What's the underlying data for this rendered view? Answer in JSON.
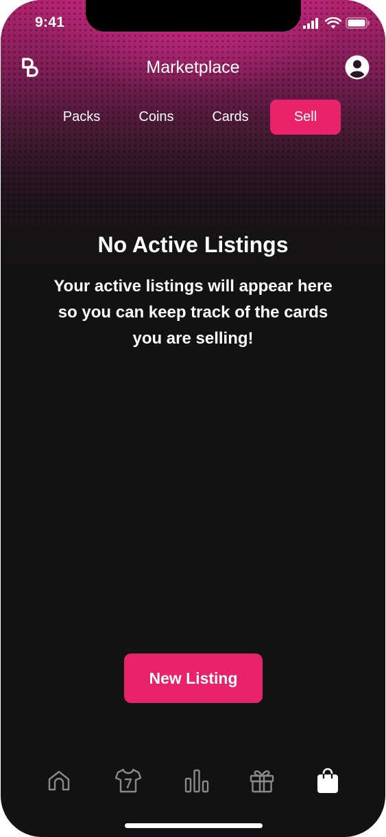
{
  "status_bar": {
    "time": "9:41",
    "icons": [
      "cellular-signal-icon",
      "wifi-icon",
      "battery-icon"
    ]
  },
  "header": {
    "logo": "logo-icon",
    "title": "Marketplace",
    "profile": "profile-icon"
  },
  "tabs": [
    {
      "label": "Packs",
      "active": false
    },
    {
      "label": "Coins",
      "active": false
    },
    {
      "label": "Cards",
      "active": false
    },
    {
      "label": "Sell",
      "active": true
    }
  ],
  "empty_state": {
    "title": "No Active Listings",
    "message": "Your active listings will appear here so you can keep track of the cards you are selling!"
  },
  "primary_action": {
    "label": "New Listing"
  },
  "tabbar": {
    "items": [
      {
        "icon": "home-icon",
        "active": false
      },
      {
        "icon": "jersey-icon",
        "active": false
      },
      {
        "icon": "bar-chart-icon",
        "active": false
      },
      {
        "icon": "gift-icon",
        "active": false
      },
      {
        "icon": "shopping-bag-icon",
        "active": true
      }
    ]
  },
  "colors": {
    "accent": "#e8236a",
    "background": "#121113",
    "inactive_icon": "#8a8a8a",
    "active_icon": "#ffffff"
  }
}
